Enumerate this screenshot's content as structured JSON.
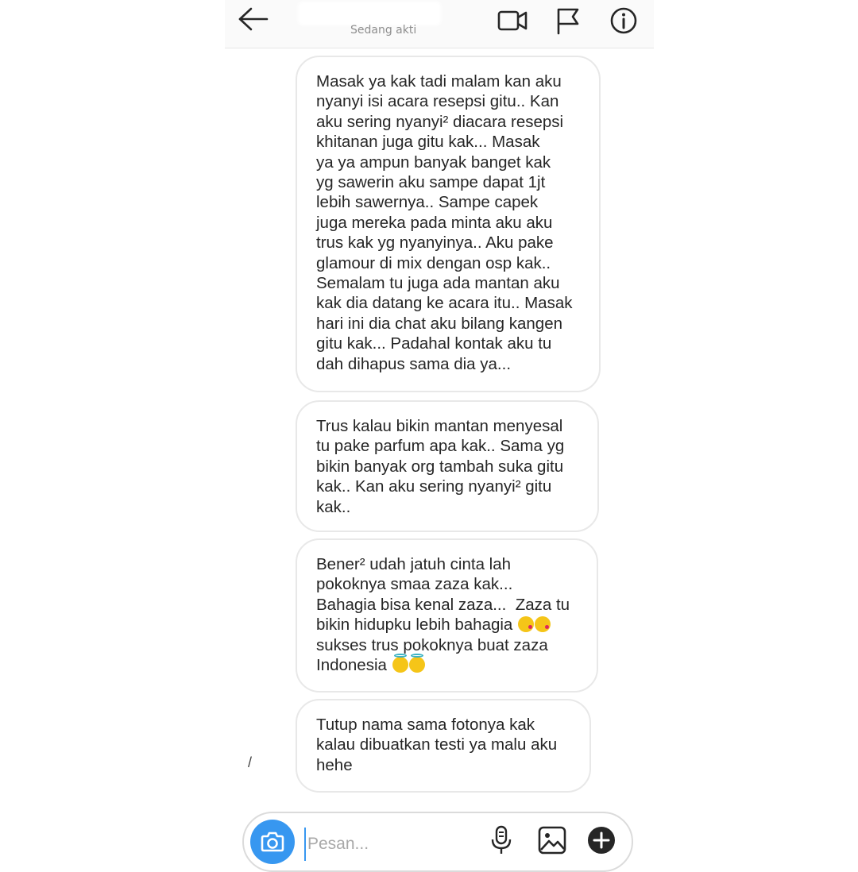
{
  "header": {
    "subtitle": "Sedang akti",
    "back_icon": "arrow-left-icon",
    "video_icon": "video-camera-icon",
    "flag_icon": "flag-icon",
    "info_icon": "info-icon"
  },
  "messages": [
    {
      "text": "Masak ya kak tadi malam kan aku\nnyanyi isi acara resepsi gitu.. Kan\naku sering nyanyi² diacara resepsi\nkhitanan juga gitu kak... Masak\nya ya ampun banyak banget kak\nyg sawerin aku sampe dapat 1jt\nlebih sawernya.. Sampe capek\njuga mereka pada minta aku aku\ntrus kak yg nyanyinya.. Aku pake\nglamour di mix dengan osp kak..\nSemalam tu juga ada mantan aku\nkak dia datang ke acara itu.. Masak\nhari ini dia chat aku bilang kangen\ngitu kak... Padahal kontak aku tu\ndah dihapus sama dia ya..."
    },
    {
      "text": "Trus kalau bikin mantan menyesal\ntu pake parfum apa kak.. Sama yg\nbikin banyak org tambah suka gitu\nkak.. Kan aku sering nyanyi² gitu\nkak.."
    },
    {
      "line1": "Bener² udah jatuh cinta lah",
      "line2": "pokoknya smaa zaza kak...",
      "line3": "Bahagia bisa kenal zaza...  Zaza tu",
      "line4": "bikin hidupku lebih bahagia ",
      "line5": "sukses trus pokoknya buat zaza",
      "line6": "Indonesia ",
      "emoji_kiss": "face-blowing-kiss-emoji",
      "emoji_halo": "smiling-face-with-halo-emoji"
    },
    {
      "text": "Tutup nama sama fotonya kak\nkalau dibuatkan testi ya malu aku\nhehe"
    }
  ],
  "stray_mark": "/",
  "composer": {
    "placeholder": "Pesan...",
    "camera_icon": "camera-icon",
    "mic_icon": "microphone-icon",
    "gallery_icon": "image-gallery-icon",
    "add_icon": "plus-circle-icon"
  },
  "colors": {
    "accent": "#3797f0",
    "bubble_border": "#e8e8e8",
    "text": "#262626",
    "muted": "#8e8e8e"
  }
}
